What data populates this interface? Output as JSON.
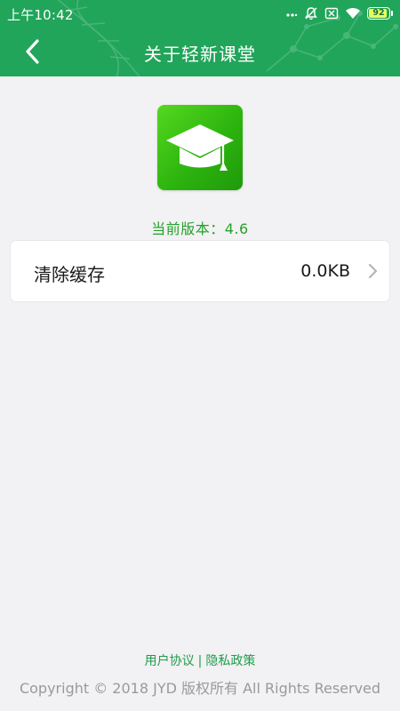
{
  "status_bar": {
    "time": "上午10:42",
    "icons": [
      "dots-icon",
      "mute-icon",
      "sim-off-icon",
      "wifi-icon",
      "battery-icon"
    ],
    "battery_level": "92",
    "battery_fraction": 0.92
  },
  "title_bar": {
    "back_icon": "chevron-left-icon",
    "title": "关于轻新课堂"
  },
  "colors": {
    "brand_green": "#21a55a",
    "version_green": "#24a22a",
    "page_background": "#f2f1f3"
  },
  "app": {
    "icon": "graduation-cap-icon",
    "version_label": "当前版本：",
    "version": "4.6"
  },
  "settings": {
    "clear_cache": {
      "label": "清除缓存",
      "value": "0.0KB",
      "icon": "chevron-right-icon"
    }
  },
  "footer": {
    "user_agreement": "用户协议",
    "separator": "|",
    "privacy_policy": "隐私政策",
    "copyright": "Copyright © 2018 JYD 版权所有 All Rights Reserved"
  }
}
